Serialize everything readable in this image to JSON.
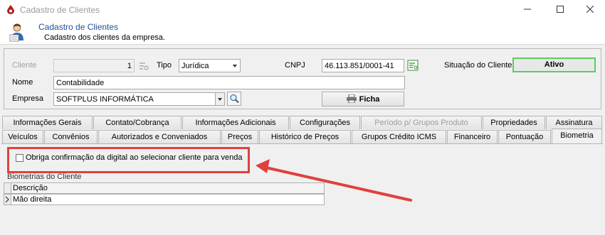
{
  "window": {
    "title": "Cadastro de Clientes",
    "buttons": {
      "minimize_icon": "minimize-icon",
      "maximize_icon": "maximize-icon",
      "close_icon": "close-icon"
    }
  },
  "header": {
    "title": "Cadastro de Clientes",
    "subtitle": "Cadastro dos clientes da empresa."
  },
  "form": {
    "cliente_label": "Cliente",
    "cliente_value": "1",
    "tipo_label": "Tipo",
    "tipo_value": "Jurídica",
    "cnpj_label": "CNPJ",
    "cnpj_value": "46.113.851/0001-41",
    "situacao_label": "Situação do Cliente",
    "situacao_value": "Ativo",
    "nome_label": "Nome",
    "nome_value": "Contabilidade",
    "empresa_label": "Empresa",
    "empresa_value": "SOFTPLUS INFORMÁTICA",
    "ficha_button": "Ficha"
  },
  "tabs_row1": [
    {
      "label": "Informações Gerais"
    },
    {
      "label": "Contato/Cobrança"
    },
    {
      "label": "Informações Adicionais"
    },
    {
      "label": "Configurações"
    },
    {
      "label": "Período p/ Grupos Produto"
    },
    {
      "label": "Propriedades"
    },
    {
      "label": "Assinatura"
    }
  ],
  "tabs_row2": [
    {
      "label": "Veículos"
    },
    {
      "label": "Convênios"
    },
    {
      "label": "Autorizados e Conveniados"
    },
    {
      "label": "Preços"
    },
    {
      "label": "Histórico de Preços"
    },
    {
      "label": "Grupos Crédito ICMS"
    },
    {
      "label": "Financeiro"
    },
    {
      "label": "Pontuação"
    },
    {
      "label": "Biometria"
    }
  ],
  "biometria": {
    "checkbox_label": "Obriga confirmação da digital ao selecionar cliente para venda",
    "checkbox_checked": false,
    "grid_caption": "Biometrias do Cliente",
    "grid_header": "Descrição",
    "rows": [
      "Mão direita"
    ]
  },
  "colors": {
    "highlight": "#e0413c",
    "status_border": "#5ecb5e",
    "header_title": "#1f4e9c"
  }
}
